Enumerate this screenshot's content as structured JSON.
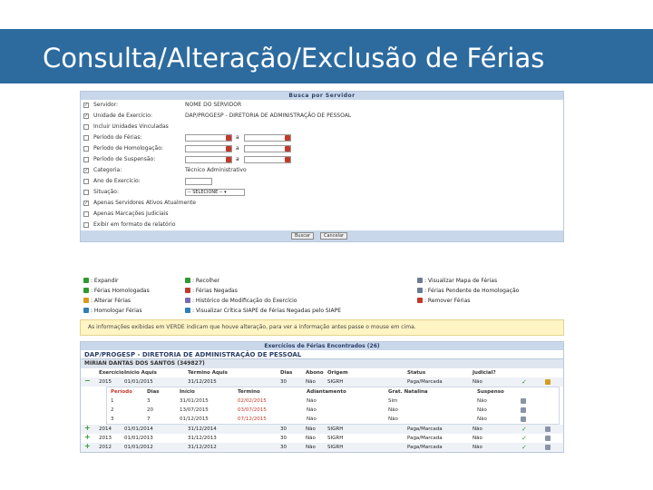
{
  "page": {
    "title": "Consulta/Alteração/Exclusão de Férias"
  },
  "form": {
    "header": "Busca por Servidor",
    "rows": [
      {
        "checked": true,
        "label": "Servidor:",
        "value": "NOME DO SERVIDOR",
        "widget": "text"
      },
      {
        "checked": true,
        "label": "Unidade de Exercício:",
        "value": "DAP/PROGESP - DIRETORIA DE ADMINISTRAÇÃO DE PESSOAL",
        "widget": "text"
      },
      {
        "checked": false,
        "label": "Incluir Unidades Vinculadas",
        "value": "",
        "widget": "none"
      },
      {
        "checked": false,
        "label": "Período de Férias:",
        "value": "",
        "widget": "daterange",
        "sep": "a"
      },
      {
        "checked": false,
        "label": "Período de Homologação:",
        "value": "",
        "widget": "daterange",
        "sep": "a"
      },
      {
        "checked": false,
        "label": "Período de Suspensão:",
        "value": "",
        "widget": "daterange",
        "sep": "a"
      },
      {
        "checked": true,
        "label": "Categoria:",
        "value": "Técnico Administrativo",
        "widget": "text"
      },
      {
        "checked": false,
        "label": "Ano de Exercício:",
        "value": "",
        "widget": "small"
      },
      {
        "checked": false,
        "label": "Situação:",
        "value": "-- SELECIONE --",
        "widget": "select"
      },
      {
        "checked": true,
        "label": "Apenas Servidores Ativos Atualmente",
        "value": "",
        "widget": "none"
      },
      {
        "checked": false,
        "label": "Apenas Marcações Judiciais",
        "value": "",
        "widget": "none"
      },
      {
        "checked": false,
        "label": "Exibir em formato de relatório",
        "value": "",
        "widget": "none"
      }
    ],
    "buttons": {
      "search": "Buscar",
      "cancel": "Cancelar"
    }
  },
  "legend": {
    "items": [
      {
        "label": ": Expandir",
        "icon": "expand-icon",
        "color": "#2e9a2e"
      },
      {
        "label": ": Recolher",
        "icon": "collapse-icon",
        "color": "#2e9a2e"
      },
      {
        "label": ": Visualizar Mapa de Férias",
        "icon": "map-icon",
        "color": "#6b7b95"
      },
      {
        "label": ": Férias Homologadas",
        "icon": "homologated-icon",
        "color": "#2e9a2e"
      },
      {
        "label": ": Férias Negadas",
        "icon": "denied-icon",
        "color": "#c0392b"
      },
      {
        "label": ": Férias Pendente de Homologação",
        "icon": "pending-icon",
        "color": "#6b7b95"
      },
      {
        "label": ": Alterar Férias",
        "icon": "edit-icon",
        "color": "#d89b1e"
      },
      {
        "label": ": Histórico de Modificação do Exercício",
        "icon": "history-icon",
        "color": "#7a6bb0"
      },
      {
        "label": ": Remover Férias",
        "icon": "remove-icon",
        "color": "#c0392b"
      },
      {
        "label": ": Homologar Férias",
        "icon": "homologate-icon",
        "color": "#2e7fb8"
      },
      {
        "label": ": Visualizar Crítica SIAPE de Férias Negadas pelo SIAPE",
        "icon": "siape-icon",
        "color": "#2e7fb8"
      }
    ]
  },
  "notice": "As informações exibidas em VERDE indicam que houve alteração, para ver a informação antes passe o mouse em cima.",
  "results": {
    "header": "Exercícios de Férias Encontrados (26)",
    "unit": "DAP/PROGESP - DIRETORIA DE ADMINISTRAÇÃO DE PESSOAL",
    "employee": "MIRIAN DANTAS DOS SANTOS (349827)",
    "columns": [
      "Exercício",
      "Início Aquis",
      "Término Aquis",
      "Dias",
      "Abono",
      "Origem",
      "Status",
      "Judicial?"
    ],
    "expanded_row": {
      "year": "2015",
      "start": "01/01/2015",
      "end": "31/12/2015",
      "days": "30",
      "abono": "Não",
      "origin": "SIGRH",
      "status": "Paga/Marcada",
      "judicial": "Não"
    },
    "sub_columns": [
      "Período",
      "Dias",
      "Início",
      "Término",
      "Adiantamento",
      "Grat. Natalina",
      "Suspenso"
    ],
    "sub_rows": [
      {
        "period": "1",
        "days": "3",
        "start": "31/01/2015",
        "end": "02/02/2015",
        "advance": "Não",
        "grat": "Sim",
        "suspended": "Não"
      },
      {
        "period": "2",
        "days": "20",
        "start": "13/07/2015",
        "end": "03/07/2015",
        "advance": "Não",
        "grat": "Não",
        "suspended": "Não"
      },
      {
        "period": "3",
        "days": "7",
        "start": "01/12/2015",
        "end": "07/12/2015",
        "advance": "Não",
        "grat": "Não",
        "suspended": "Não"
      }
    ],
    "rows": [
      {
        "year": "2014",
        "start": "01/01/2014",
        "end": "31/12/2014",
        "days": "30",
        "abono": "Não",
        "origin": "SIGRH",
        "status": "Paga/Marcada",
        "judicial": "Não"
      },
      {
        "year": "2013",
        "start": "01/01/2013",
        "end": "31/12/2013",
        "days": "30",
        "abono": "Não",
        "origin": "SIGRH",
        "status": "Paga/Marcada",
        "judicial": "Não"
      },
      {
        "year": "2012",
        "start": "01/01/2012",
        "end": "31/12/2012",
        "days": "30",
        "abono": "Não",
        "origin": "SIGRH",
        "status": "Paga/Marcada",
        "judicial": "Não"
      }
    ]
  }
}
